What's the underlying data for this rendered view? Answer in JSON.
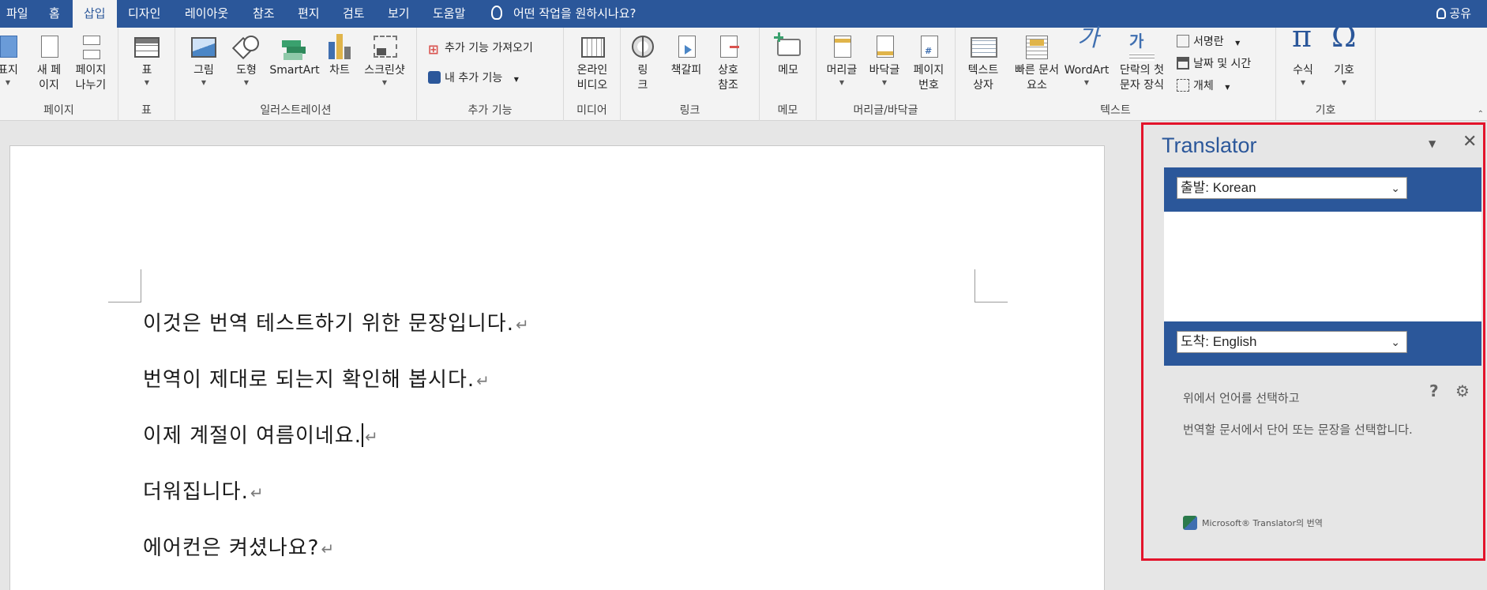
{
  "menubar": {
    "tabs": [
      {
        "label": "파일"
      },
      {
        "label": "홈"
      },
      {
        "label": "삽입"
      },
      {
        "label": "디자인"
      },
      {
        "label": "레이아웃"
      },
      {
        "label": "참조"
      },
      {
        "label": "편지"
      },
      {
        "label": "검토"
      },
      {
        "label": "보기"
      },
      {
        "label": "도움말"
      }
    ],
    "active_tab": "삽입",
    "tell_me": "어떤 작업을 원하시나요?",
    "share": "공유"
  },
  "ribbon": {
    "pages": {
      "cover": "표지",
      "blank": "새 페이지",
      "blank_line1": "새 페",
      "blank_line2": "이지",
      "break_line1": "페이지",
      "break_line2": "나누기",
      "label": "페이지"
    },
    "tables": {
      "table": "표",
      "label": "표"
    },
    "illustrations": {
      "pictures": "그림",
      "shapes": "도형",
      "smartart": "SmartArt",
      "chart": "차트",
      "screenshot": "스크린샷",
      "label": "일러스트레이션"
    },
    "addins": {
      "get": "추가 기능 가져오기",
      "my": "내 추가 기능",
      "label": "추가 기능"
    },
    "media": {
      "video_line1": "온라인",
      "video_line2": "비디오",
      "label": "미디어"
    },
    "links": {
      "link_line1": "링",
      "link_line2": "크",
      "bookmark": "책갈피",
      "xref_line1": "상호",
      "xref_line2": "참조",
      "label": "링크"
    },
    "comments": {
      "comment": "메모",
      "label": "메모"
    },
    "header_footer": {
      "header": "머리글",
      "footer": "바닥글",
      "pnum_line1": "페이지",
      "pnum_line2": "번호",
      "label": "머리글/바닥글"
    },
    "text": {
      "textbox_line1": "텍스트",
      "textbox_line2": "상자",
      "quick_line1": "빠른 문서",
      "quick_line2": "요소",
      "wordart": "WordArt",
      "dropcap_line1": "단락의 첫",
      "dropcap_line2": "문자 장식",
      "signature": "서명란",
      "datetime": "날짜 및 시간",
      "object": "개체",
      "label": "텍스트"
    },
    "symbols": {
      "equation": "수식",
      "symbol": "기호",
      "label": "기호"
    }
  },
  "document": {
    "paragraphs": [
      {
        "text": "이것은 번역 테스트하기 위한 문장입니다."
      },
      {
        "text": "번역이 제대로 되는지 확인해 봅시다."
      },
      {
        "text": "이제 계절이 여름이네요."
      },
      {
        "text": "더워집니다."
      },
      {
        "text": "에어컨은 켜셨나요?"
      }
    ],
    "para_mark": "↵"
  },
  "translator": {
    "title": "Translator",
    "from": "출발: Korean",
    "to": "도착: English",
    "hint1": "위에서 언어를 선택하고",
    "hint2": "번역할 문서에서 단어 또는 문장을 선택합니다.",
    "credit": "Microsoft® Translator의 번역"
  },
  "colors": {
    "brand": "#2b579a",
    "highlight_border": "#e3142b"
  }
}
